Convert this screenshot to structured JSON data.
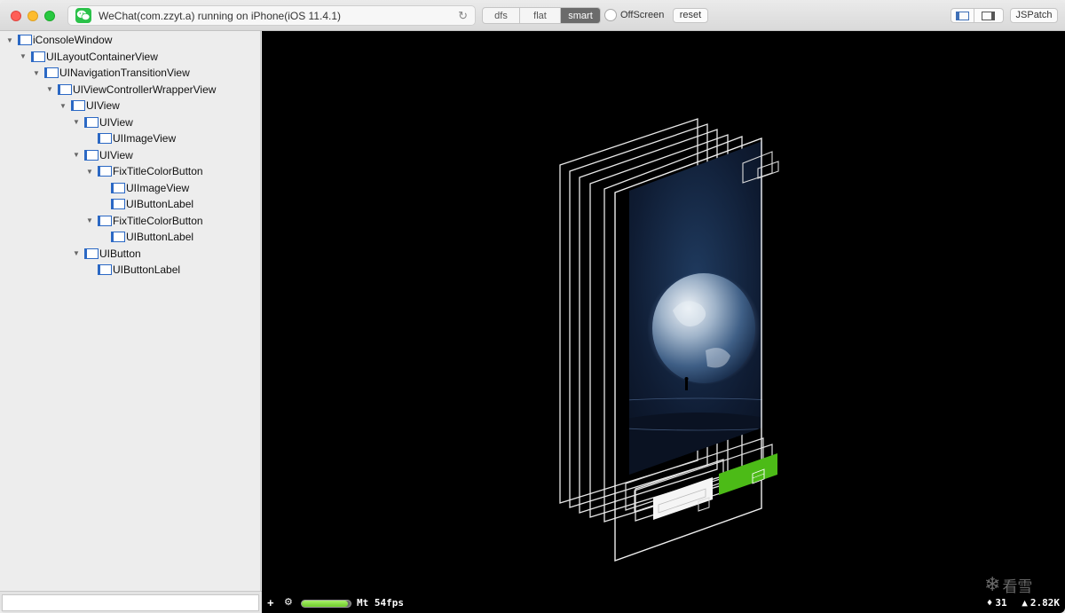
{
  "window": {
    "url_text": "WeChat(com.zzyt.a) running on iPhone(iOS 11.4.1)",
    "reload_glyph": "↻"
  },
  "toolbar": {
    "modes": [
      {
        "label": "dfs",
        "selected": false
      },
      {
        "label": "flat",
        "selected": false
      },
      {
        "label": "smart",
        "selected": true
      }
    ],
    "offscreen_label": "OffScreen",
    "reset_label": "reset",
    "jspatch_label": "JSPatch"
  },
  "tree": [
    {
      "label": "iConsoleWindow",
      "depth": 0,
      "expanded": true
    },
    {
      "label": "UILayoutContainerView",
      "depth": 1,
      "expanded": true
    },
    {
      "label": "UINavigationTransitionView",
      "depth": 2,
      "expanded": true
    },
    {
      "label": "UIViewControllerWrapperView",
      "depth": 3,
      "expanded": true
    },
    {
      "label": "UIView",
      "depth": 4,
      "expanded": true
    },
    {
      "label": "UIView",
      "depth": 5,
      "expanded": true
    },
    {
      "label": "UIImageView",
      "depth": 6,
      "expanded": null
    },
    {
      "label": "UIView",
      "depth": 5,
      "expanded": true
    },
    {
      "label": "FixTitleColorButton",
      "depth": 6,
      "expanded": true
    },
    {
      "label": "UIImageView",
      "depth": 7,
      "expanded": null
    },
    {
      "label": "UIButtonLabel",
      "depth": 7,
      "expanded": null
    },
    {
      "label": "FixTitleColorButton",
      "depth": 6,
      "expanded": true
    },
    {
      "label": "UIButtonLabel",
      "depth": 7,
      "expanded": null
    },
    {
      "label": "UIButton",
      "depth": 5,
      "expanded": true
    },
    {
      "label": "UIButtonLabel",
      "depth": 6,
      "expanded": null
    }
  ],
  "filter": {
    "value": "",
    "placeholder": ""
  },
  "status": {
    "plus_glyph": "+",
    "gear_glyph": "⚙",
    "perf_level": 0.95,
    "fps_text": "Mt 54fps",
    "views_icon": "♦",
    "views_count": "31",
    "triangles_icon": "▲",
    "triangles_count": "2.82K"
  },
  "watermark": {
    "icon": "❄",
    "text": "看雪"
  },
  "colors": {
    "accent_green": "#4cbb17",
    "canvas_bg": "#000000",
    "layer_stroke": "#e8e8e8",
    "view_icon_blue": "#2b68c4"
  }
}
